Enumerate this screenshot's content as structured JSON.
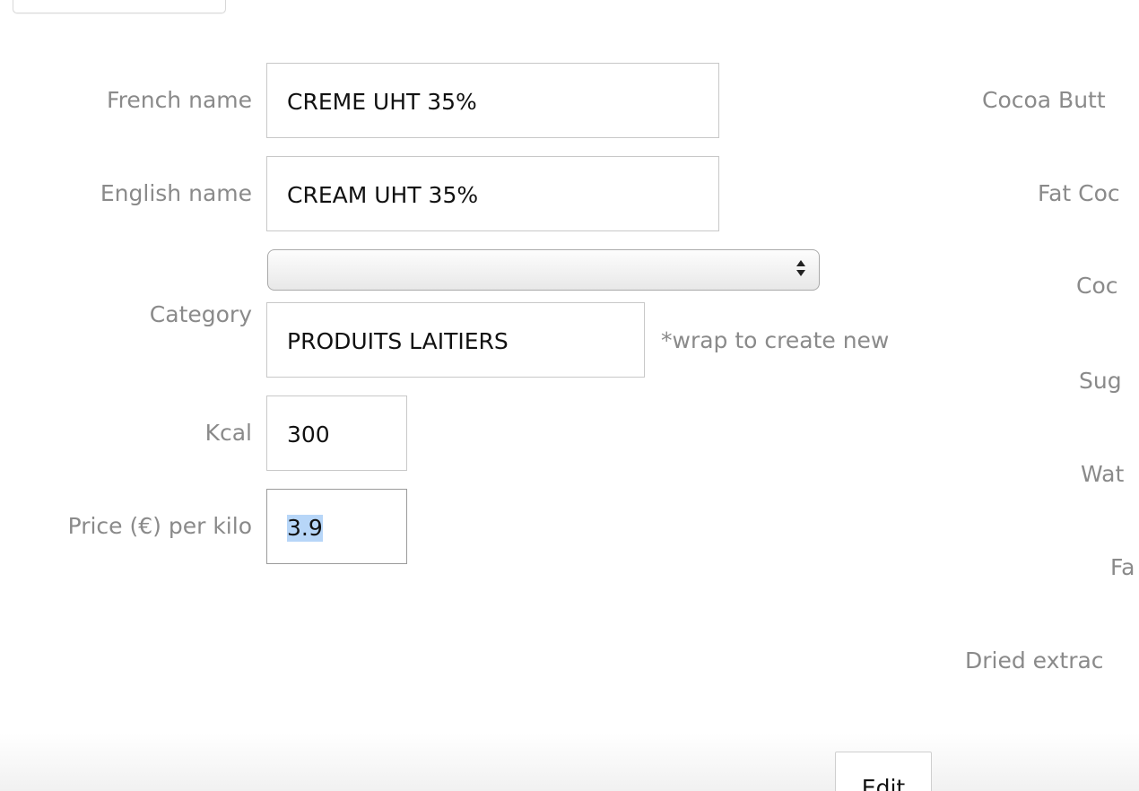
{
  "form": {
    "french_name": {
      "label": "French name",
      "value": "CREME UHT 35%"
    },
    "english_name": {
      "label": "English name",
      "value": "CREAM UHT 35%"
    },
    "category": {
      "label": "Category",
      "select_value": "",
      "new_value": "PRODUITS LAITIERS",
      "hint": "*wrap to create new"
    },
    "kcal": {
      "label": "Kcal",
      "value": "300"
    },
    "price": {
      "label": "Price (€) per kilo",
      "value": "3.9"
    }
  },
  "right_column": {
    "labels": [
      "Cocoa Butt",
      "Fat Coc",
      "Coc",
      "Sug",
      "Wat",
      "Fa",
      "Dried extrac"
    ]
  },
  "footer": {
    "edit_label": "Edit"
  },
  "icons": {
    "select_arrows": "select-updown-icon"
  }
}
